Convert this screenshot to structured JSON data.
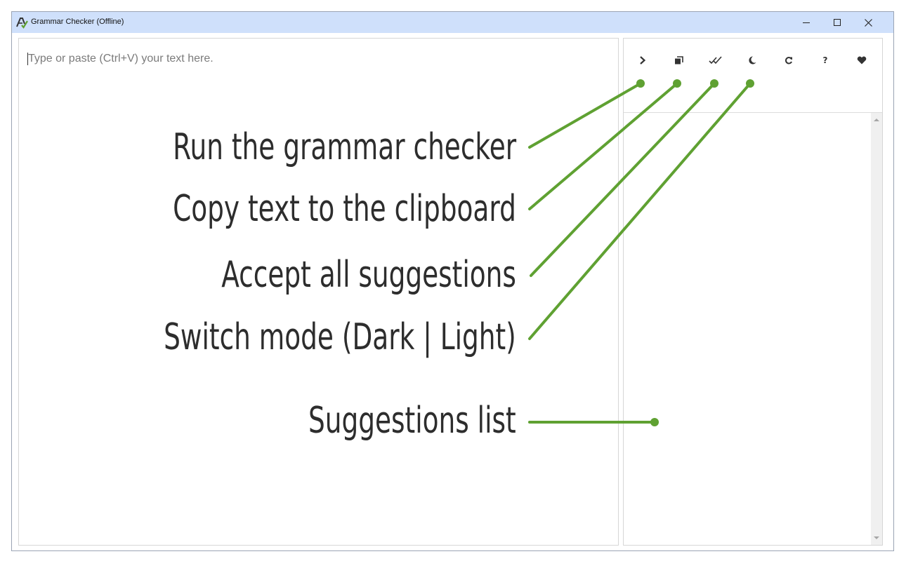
{
  "window": {
    "title": "Grammar Checker (Offline)",
    "controls": [
      "minimize-icon",
      "maximize-icon",
      "close-icon"
    ]
  },
  "editor": {
    "placeholder": "Type or paste (Ctrl+V) your text here."
  },
  "toolbar": {
    "buttons": [
      {
        "icon": "chevron-right-icon",
        "action": "run"
      },
      {
        "icon": "copy-icon",
        "action": "copy"
      },
      {
        "icon": "double-check-icon",
        "action": "accept-all"
      },
      {
        "icon": "moon-icon",
        "action": "switch-mode"
      },
      {
        "icon": "refresh-icon",
        "action": "refresh"
      },
      {
        "icon": "question-icon",
        "label": "?"
      },
      {
        "icon": "heart-icon",
        "action": "favorite"
      }
    ]
  },
  "callouts": {
    "run": "Run the grammar checker",
    "copy": "Copy text to the clipboard",
    "accept_all": "Accept all suggestions",
    "switch_mode": "Switch mode (Dark | Light)",
    "suggestions_list": "Suggestions list"
  },
  "colors": {
    "titlebar": "#cfe0fb",
    "callout_line": "#5fa132",
    "callout_text": "#2d2d2d",
    "icon": "#333333"
  }
}
